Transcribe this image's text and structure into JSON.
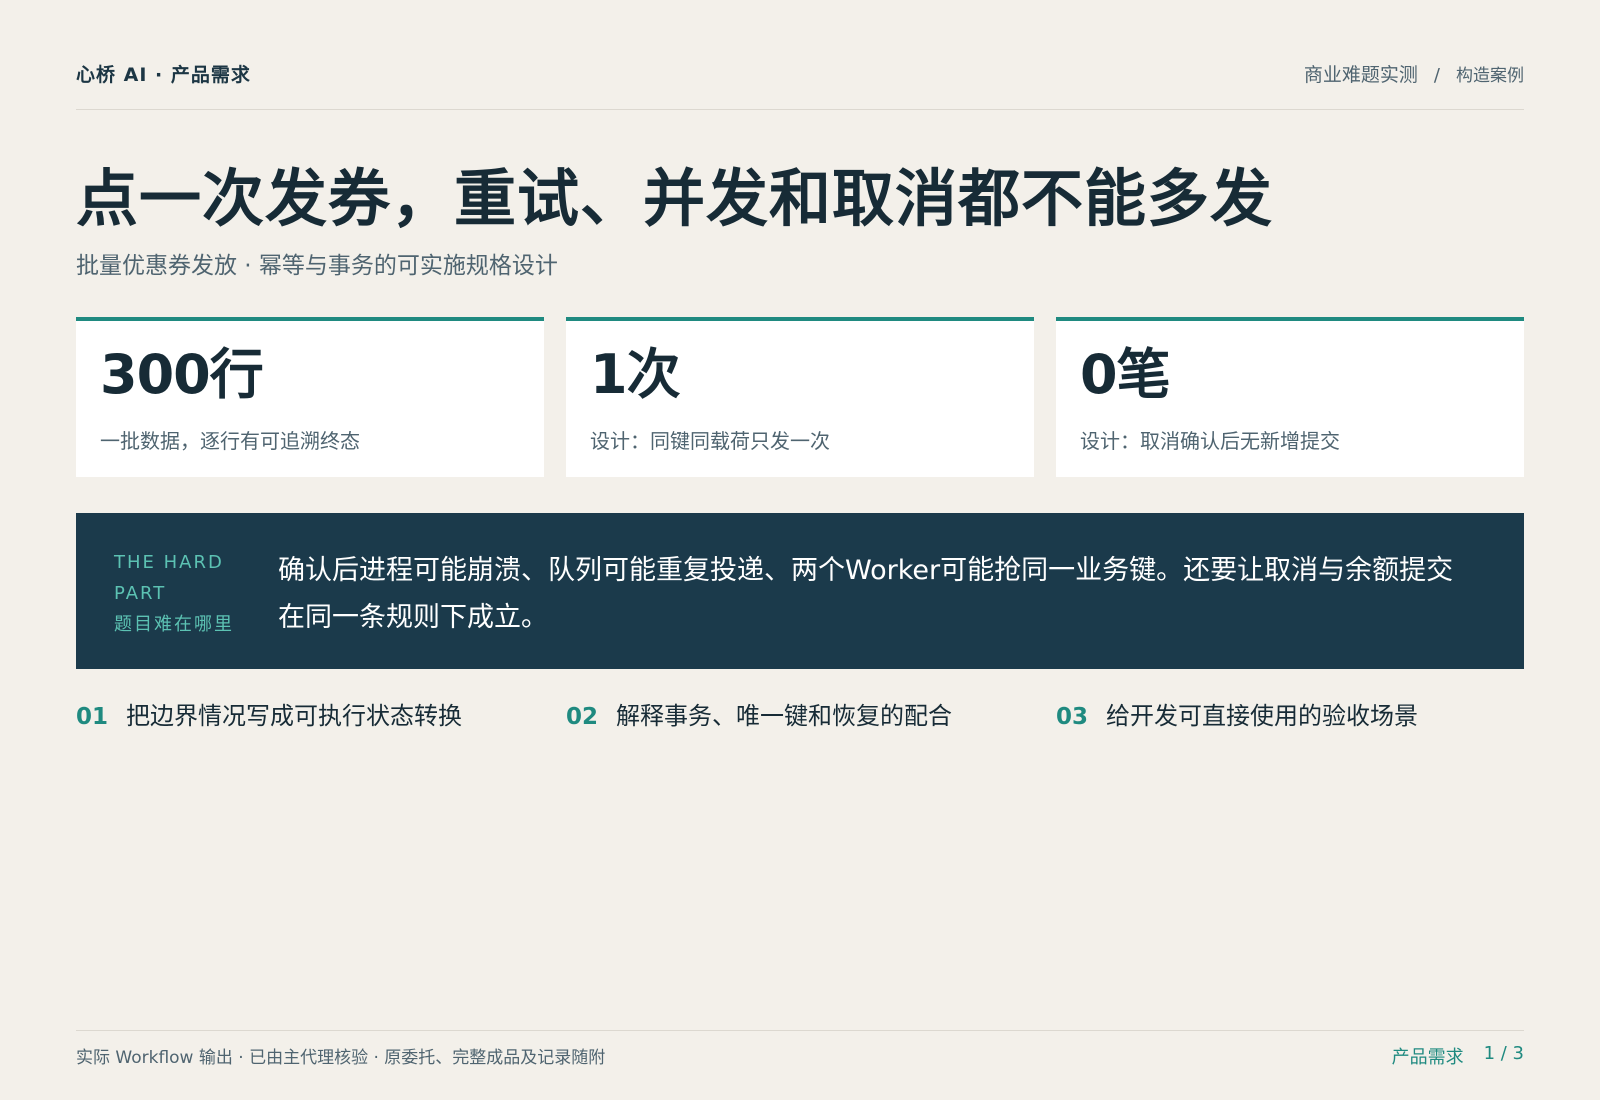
{
  "header": {
    "brand": "心桥 AI · 产品需求",
    "breadcrumb_main": "商业难题实测",
    "breadcrumb_separator": "/",
    "breadcrumb_sub": "构造案例"
  },
  "title": "点一次发券，重试、并发和取消都不能多发",
  "subtitle": "批量优惠券发放 · 幂等与事务的可实施规格设计",
  "stats": [
    {
      "value": "300行",
      "label": "一批数据，逐行有可追溯终态"
    },
    {
      "value": "1次",
      "label": "设计：同键同载荷只发一次"
    },
    {
      "value": "0笔",
      "label": "设计：取消确认后无新增提交"
    }
  ],
  "hard_part": {
    "kicker_en": "THE HARD PART",
    "kicker_zh": "题目难在哪里",
    "text": "确认后进程可能崩溃、队列可能重复投递、两个Worker可能抢同一业务键。还要让取消与余额提交在同一条规则下成立。"
  },
  "points": [
    {
      "num": "01",
      "text": "把边界情况写成可执行状态转换"
    },
    {
      "num": "02",
      "text": "解释事务、唯一键和恢复的配合"
    },
    {
      "num": "03",
      "text": "给开发可直接使用的验收场景"
    }
  ],
  "footer": {
    "note": "实际 Workflow 输出 · 已由主代理核验 · 原委托、完整成品及记录随附",
    "section": "产品需求",
    "page": "1 / 3"
  },
  "colors": {
    "background": "#f3f0ea",
    "accent": "#1f8a80",
    "dark_panel": "#1b3a4b",
    "text": "#172b36"
  }
}
